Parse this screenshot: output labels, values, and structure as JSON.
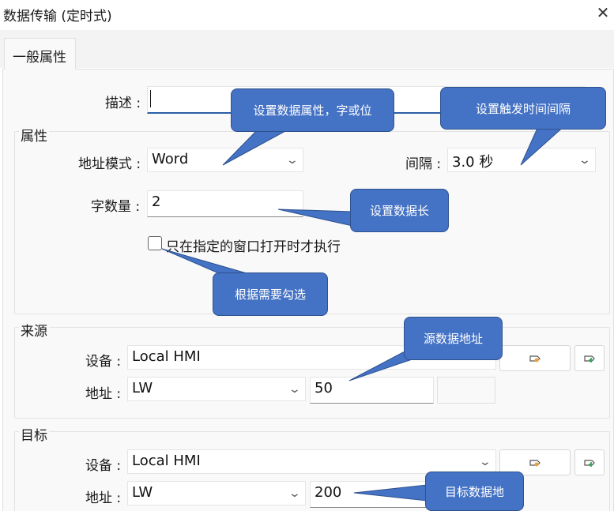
{
  "window": {
    "title": "数据传输 (定时式)",
    "close_glyph": "✕"
  },
  "tabs": [
    {
      "label": "一般属性"
    }
  ],
  "description": {
    "label": "描述 :",
    "value": ""
  },
  "attributes": {
    "group_title": "属性",
    "address_mode": {
      "label": "地址模式 :",
      "value": "Word"
    },
    "interval": {
      "label": "间隔 :",
      "value": "3.0  秒"
    },
    "word_count": {
      "label": "字数量 :",
      "value": "2"
    },
    "only_when_window_open": {
      "label": "只在指定的窗口打开时才执行",
      "checked": false
    }
  },
  "source": {
    "group_title": "来源",
    "device": {
      "label": "设备 :",
      "value": "Local HMI"
    },
    "address": {
      "label": "地址 :",
      "type": "LW",
      "value": "50"
    }
  },
  "target": {
    "group_title": "目标",
    "device": {
      "label": "设备 :",
      "value": "Local HMI"
    },
    "address": {
      "label": "地址 :",
      "type": "LW",
      "value": "200"
    }
  },
  "callouts": {
    "set_data_attr": "设置数据属性，字或位",
    "set_trigger_interval": "设置触发时间间隔",
    "set_data_length": "设置数据长",
    "check_as_needed": "根据需要勾选",
    "source_address": "源数据地址",
    "target_address": "目标数据地"
  },
  "colors": {
    "callout_fill": "#4472C4",
    "callout_border": "#2F528F",
    "accent": "#2B5FA6"
  }
}
